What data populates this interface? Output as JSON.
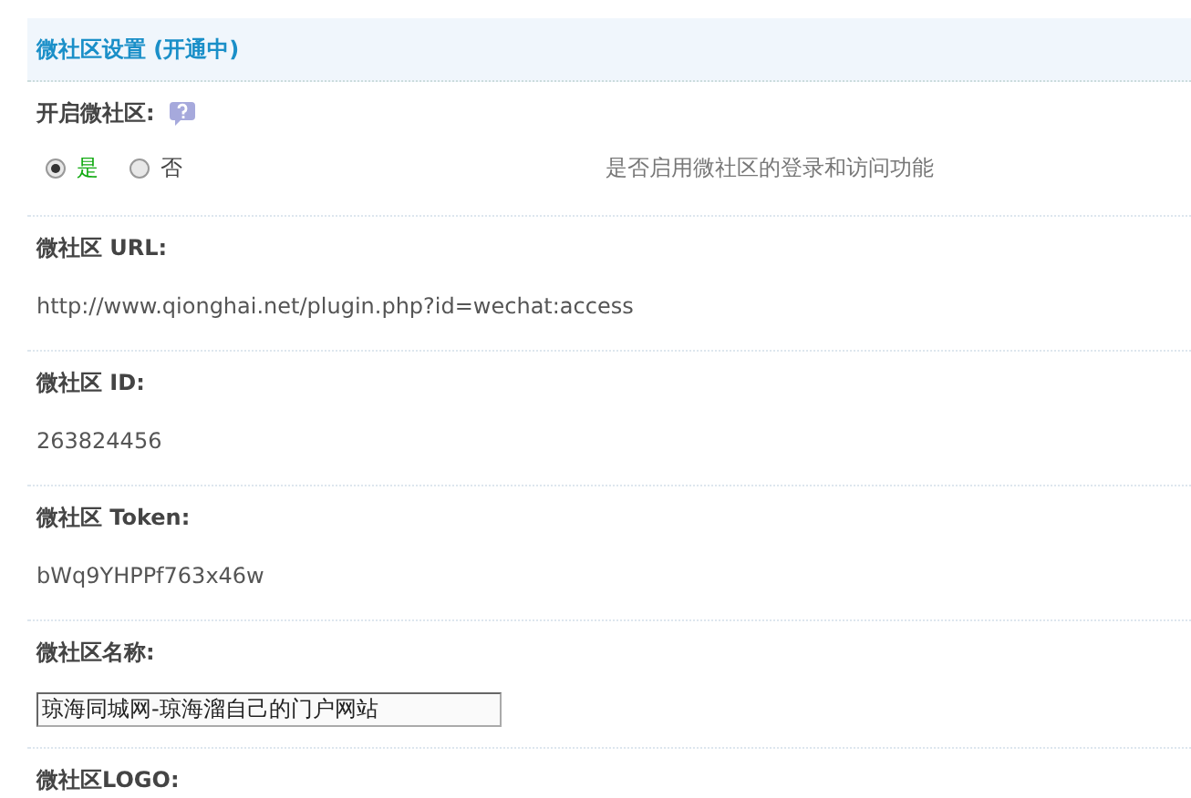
{
  "header": {
    "title": "微社区设置 (开通中)"
  },
  "settings": [
    {
      "kind": "radio",
      "label": "开启微社区:",
      "help": true,
      "options": [
        {
          "label": "是",
          "selected": true
        },
        {
          "label": "否",
          "selected": false
        }
      ],
      "hint": "是否启用微社区的登录和访问功能"
    },
    {
      "kind": "text",
      "label": "微社区 URL:",
      "value": "http://www.qionghai.net/plugin.php?id=wechat:access"
    },
    {
      "kind": "text",
      "label": "微社区 ID:",
      "value": "263824456"
    },
    {
      "kind": "text",
      "label": "微社区 Token:",
      "value": "bWq9YHPPf763x46w"
    },
    {
      "kind": "input",
      "label": "微社区名称:",
      "value": "琼海同城网-琼海溜自己的门户网站"
    },
    {
      "kind": "label",
      "label": "微社区LOGO:"
    }
  ]
}
